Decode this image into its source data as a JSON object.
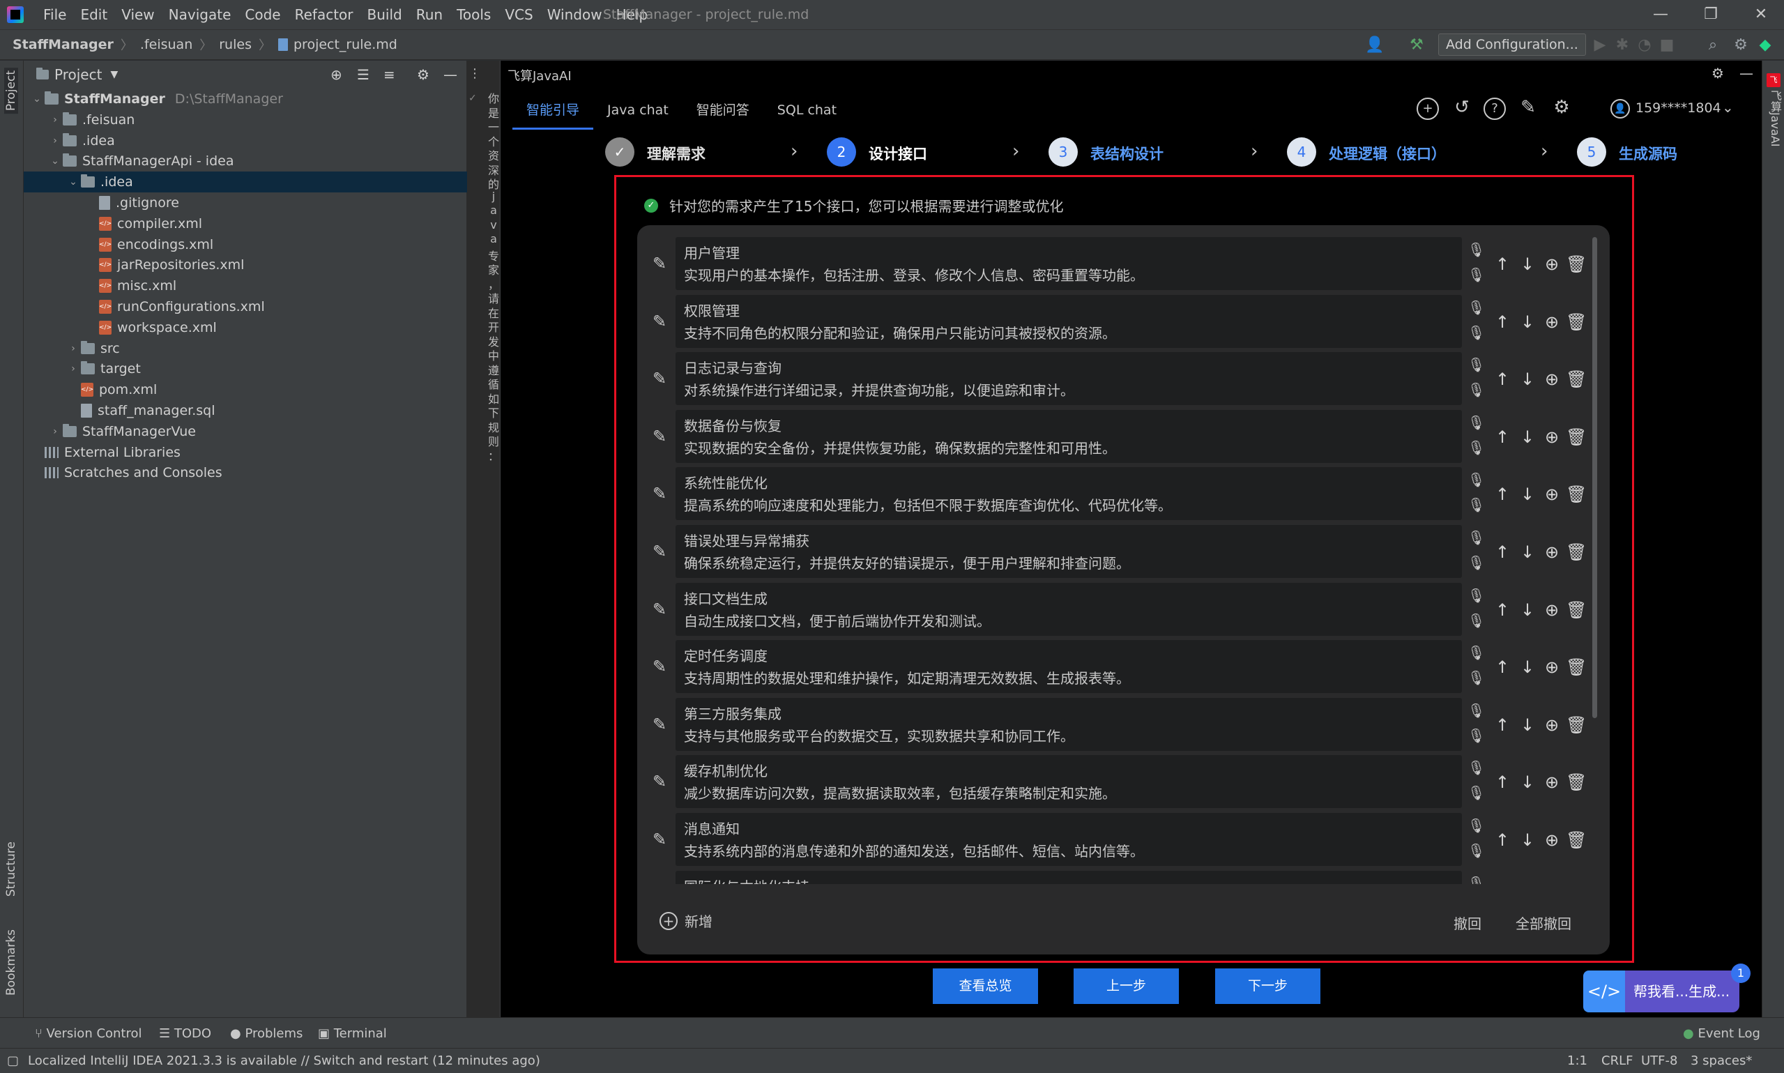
{
  "window": {
    "title": "StaffManager - project_rule.md",
    "menu": [
      "File",
      "Edit",
      "View",
      "Navigate",
      "Code",
      "Refactor",
      "Build",
      "Run",
      "Tools",
      "VCS",
      "Window",
      "Help"
    ]
  },
  "navbar": {
    "breadcrumbs": [
      "StaffManager",
      ".feisuan",
      "rules",
      "project_rule.md"
    ],
    "run_config": "Add Configuration..."
  },
  "left_strip": {
    "project_label": "Project",
    "structure_label": "Structure",
    "bookmarks_label": "Bookmarks"
  },
  "project_panel": {
    "header": "Project",
    "tree": [
      {
        "label": "StaffManager",
        "extra": "D:\\StaffManager",
        "type": "folder",
        "level": 0,
        "expanded": true
      },
      {
        "label": ".feisuan",
        "type": "folder",
        "level": 1,
        "expanded": false
      },
      {
        "label": ".idea",
        "type": "folder",
        "level": 1,
        "expanded": false
      },
      {
        "label": "StaffManagerApi - idea",
        "type": "folder",
        "level": 1,
        "expanded": true
      },
      {
        "label": ".idea",
        "type": "folder",
        "level": 2,
        "expanded": true,
        "selected": true
      },
      {
        "label": ".gitignore",
        "type": "txt",
        "level": 3
      },
      {
        "label": "compiler.xml",
        "type": "xml",
        "level": 3
      },
      {
        "label": "encodings.xml",
        "type": "xml",
        "level": 3
      },
      {
        "label": "jarRepositories.xml",
        "type": "xml",
        "level": 3
      },
      {
        "label": "misc.xml",
        "type": "xml",
        "level": 3
      },
      {
        "label": "runConfigurations.xml",
        "type": "xml",
        "level": 3
      },
      {
        "label": "workspace.xml",
        "type": "xml",
        "level": 3
      },
      {
        "label": "src",
        "type": "folder",
        "level": 2,
        "expanded": false
      },
      {
        "label": "target",
        "type": "folder",
        "level": 2,
        "expanded": false
      },
      {
        "label": "pom.xml",
        "type": "xml",
        "level": 2
      },
      {
        "label": "staff_manager.sql",
        "type": "txt",
        "level": 2
      },
      {
        "label": "StaffManagerVue",
        "type": "folder",
        "level": 1,
        "expanded": false
      },
      {
        "label": "External Libraries",
        "type": "lib",
        "level": 0
      },
      {
        "label": "Scratches and Consoles",
        "type": "lib",
        "level": 0
      }
    ]
  },
  "editor_strip": {
    "chars": [
      "你",
      "是",
      "一",
      "个",
      "资",
      "深",
      "的",
      "j",
      "a",
      "v",
      "a",
      "专",
      "家",
      "，",
      "请",
      "在",
      "开",
      "发",
      "中",
      "遵",
      "循",
      "如",
      "下",
      "规",
      "则",
      "："
    ]
  },
  "feisuan": {
    "title": "飞算JavaAI",
    "tabs": [
      "智能引导",
      "Java chat",
      "智能问答",
      "SQL chat"
    ],
    "active_tab": 0,
    "user": "159****1804",
    "steps": [
      {
        "num": "✓",
        "label": "理解需求",
        "state": "done"
      },
      {
        "num": "2",
        "label": "设计接口",
        "state": "current"
      },
      {
        "num": "3",
        "label": "表结构设计",
        "state": "pending"
      },
      {
        "num": "4",
        "label": "处理逻辑（接口）",
        "state": "pending"
      },
      {
        "num": "5",
        "label": "生成源码",
        "state": "pending"
      }
    ],
    "summary": "针对您的需求产生了15个接口，您可以根据需要进行调整或优化",
    "items": [
      {
        "title": "用户管理",
        "desc": "实现用户的基本操作，包括注册、登录、修改个人信息、密码重置等功能。"
      },
      {
        "title": "权限管理",
        "desc": "支持不同角色的权限分配和验证，确保用户只能访问其被授权的资源。"
      },
      {
        "title": "日志记录与查询",
        "desc": "对系统操作进行详细记录，并提供查询功能，以便追踪和审计。"
      },
      {
        "title": "数据备份与恢复",
        "desc": "实现数据的安全备份，并提供恢复功能，确保数据的完整性和可用性。"
      },
      {
        "title": "系统性能优化",
        "desc": "提高系统的响应速度和处理能力，包括但不限于数据库查询优化、代码优化等。"
      },
      {
        "title": "错误处理与异常捕获",
        "desc": "确保系统稳定运行，并提供友好的错误提示，便于用户理解和排查问题。"
      },
      {
        "title": "接口文档生成",
        "desc": "自动生成接口文档，便于前后端协作开发和测试。"
      },
      {
        "title": "定时任务调度",
        "desc": "支持周期性的数据处理和维护操作，如定期清理无效数据、生成报表等。"
      },
      {
        "title": "第三方服务集成",
        "desc": "支持与其他服务或平台的数据交互，实现数据共享和协同工作。"
      },
      {
        "title": "缓存机制优化",
        "desc": "减少数据库访问次数，提高数据读取效率，包括缓存策略制定和实施。"
      },
      {
        "title": "消息通知",
        "desc": "支持系统内部的消息传递和外部的通知发送，包括邮件、短信、站内信等。"
      },
      {
        "title": "国际化与本地化支持",
        "desc": ""
      }
    ],
    "add_label": "新增",
    "undo_label": "撤回",
    "undo_all_label": "全部撤回",
    "buttons": {
      "overview": "查看总览",
      "prev": "上一步",
      "next": "下一步"
    },
    "help": {
      "text": "帮我看...生成...",
      "badge": "1"
    },
    "right_label": "飞算JavaAI",
    "colors": {
      "primary": "#1e6fe0",
      "active_step": "#3574f0",
      "highlight_box": "#e81123",
      "step_link": "#5a9cf8"
    }
  },
  "bottom": {
    "tools": [
      "Version Control",
      "TODO",
      "Problems",
      "Terminal"
    ],
    "event_log": "Event Log",
    "status_message": "Localized IntelliJ IDEA 2021.3.3 is available // Switch and restart (12 minutes ago)",
    "position": "1:1",
    "line_sep": "CRLF",
    "encoding": "UTF-8",
    "indent": "3 spaces*"
  }
}
